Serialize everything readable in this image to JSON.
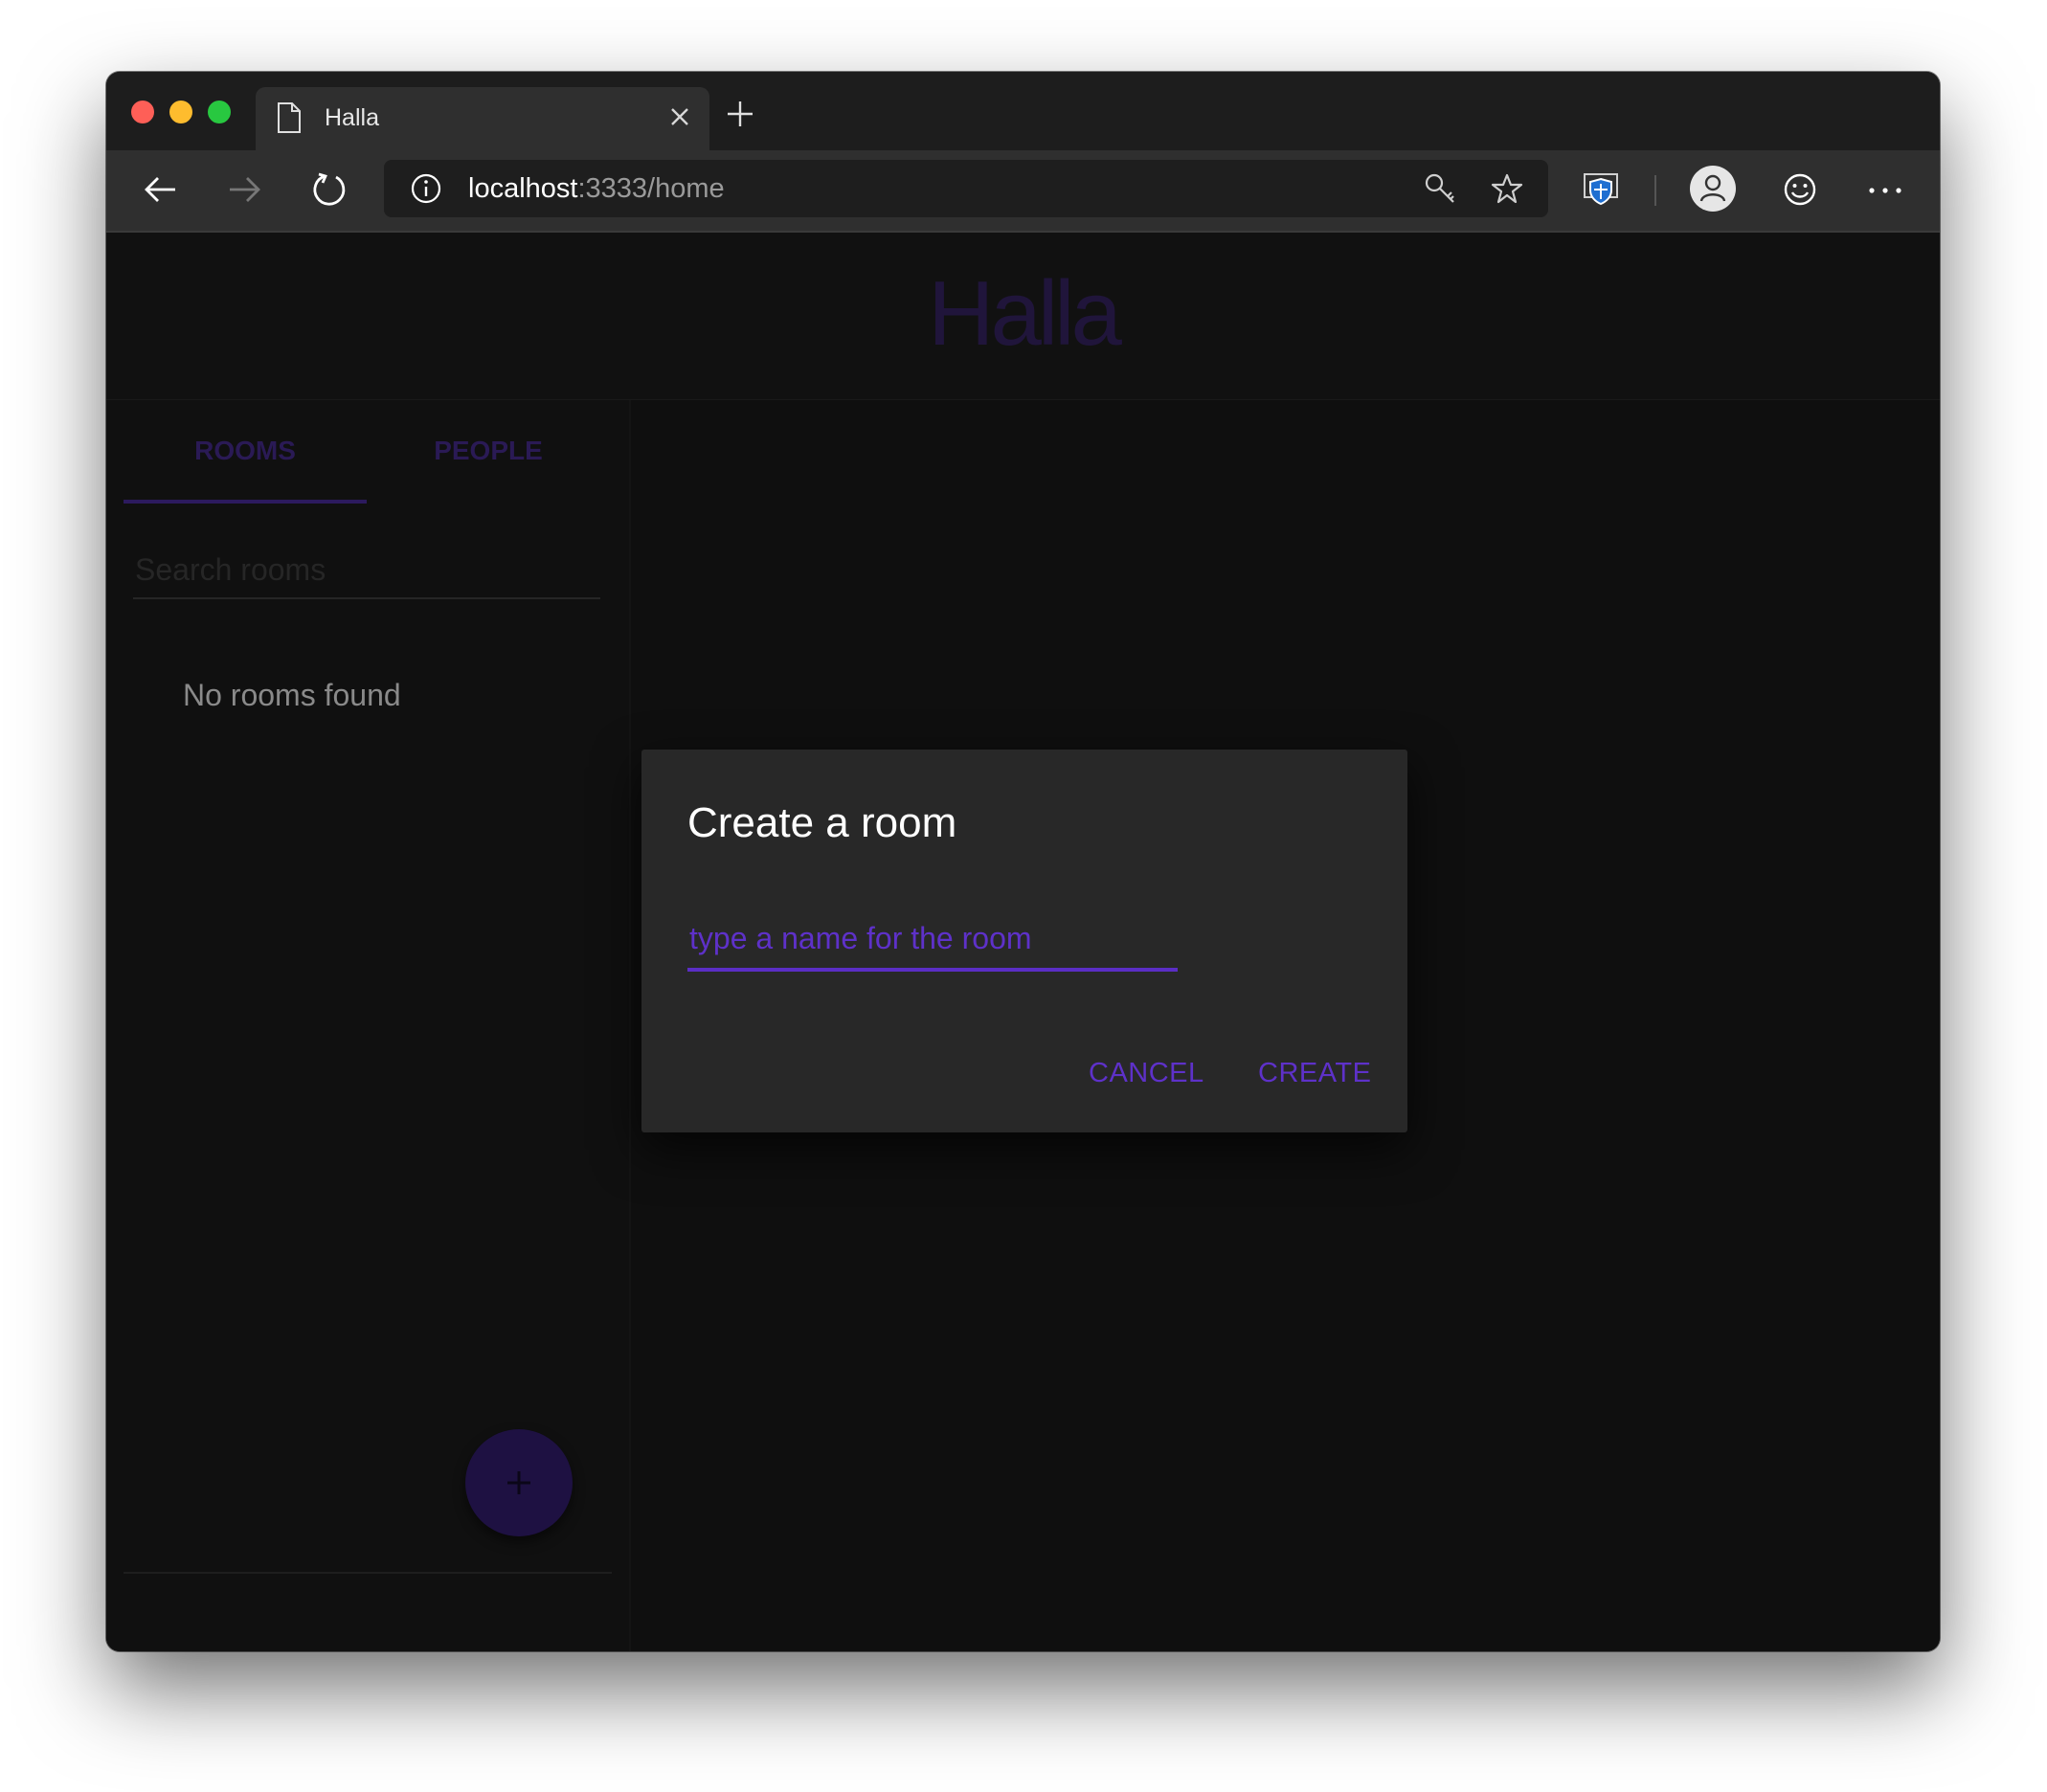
{
  "browser": {
    "tab_title": "Halla",
    "url_host": "localhost",
    "url_rest": ":3333/home"
  },
  "app": {
    "title": "Halla"
  },
  "sidebar": {
    "tabs": [
      {
        "label": "ROOMS",
        "active": true
      },
      {
        "label": "PEOPLE",
        "active": false
      }
    ],
    "search_placeholder": "Search rooms",
    "empty_text": "No rooms found"
  },
  "dialog": {
    "title": "Create a room",
    "input_placeholder": "type a name for the room",
    "cancel_label": "CANCEL",
    "create_label": "CREATE"
  },
  "colors": {
    "accent": "#5e31c9",
    "background": "#0f0f0f",
    "dialog": "#282828"
  }
}
